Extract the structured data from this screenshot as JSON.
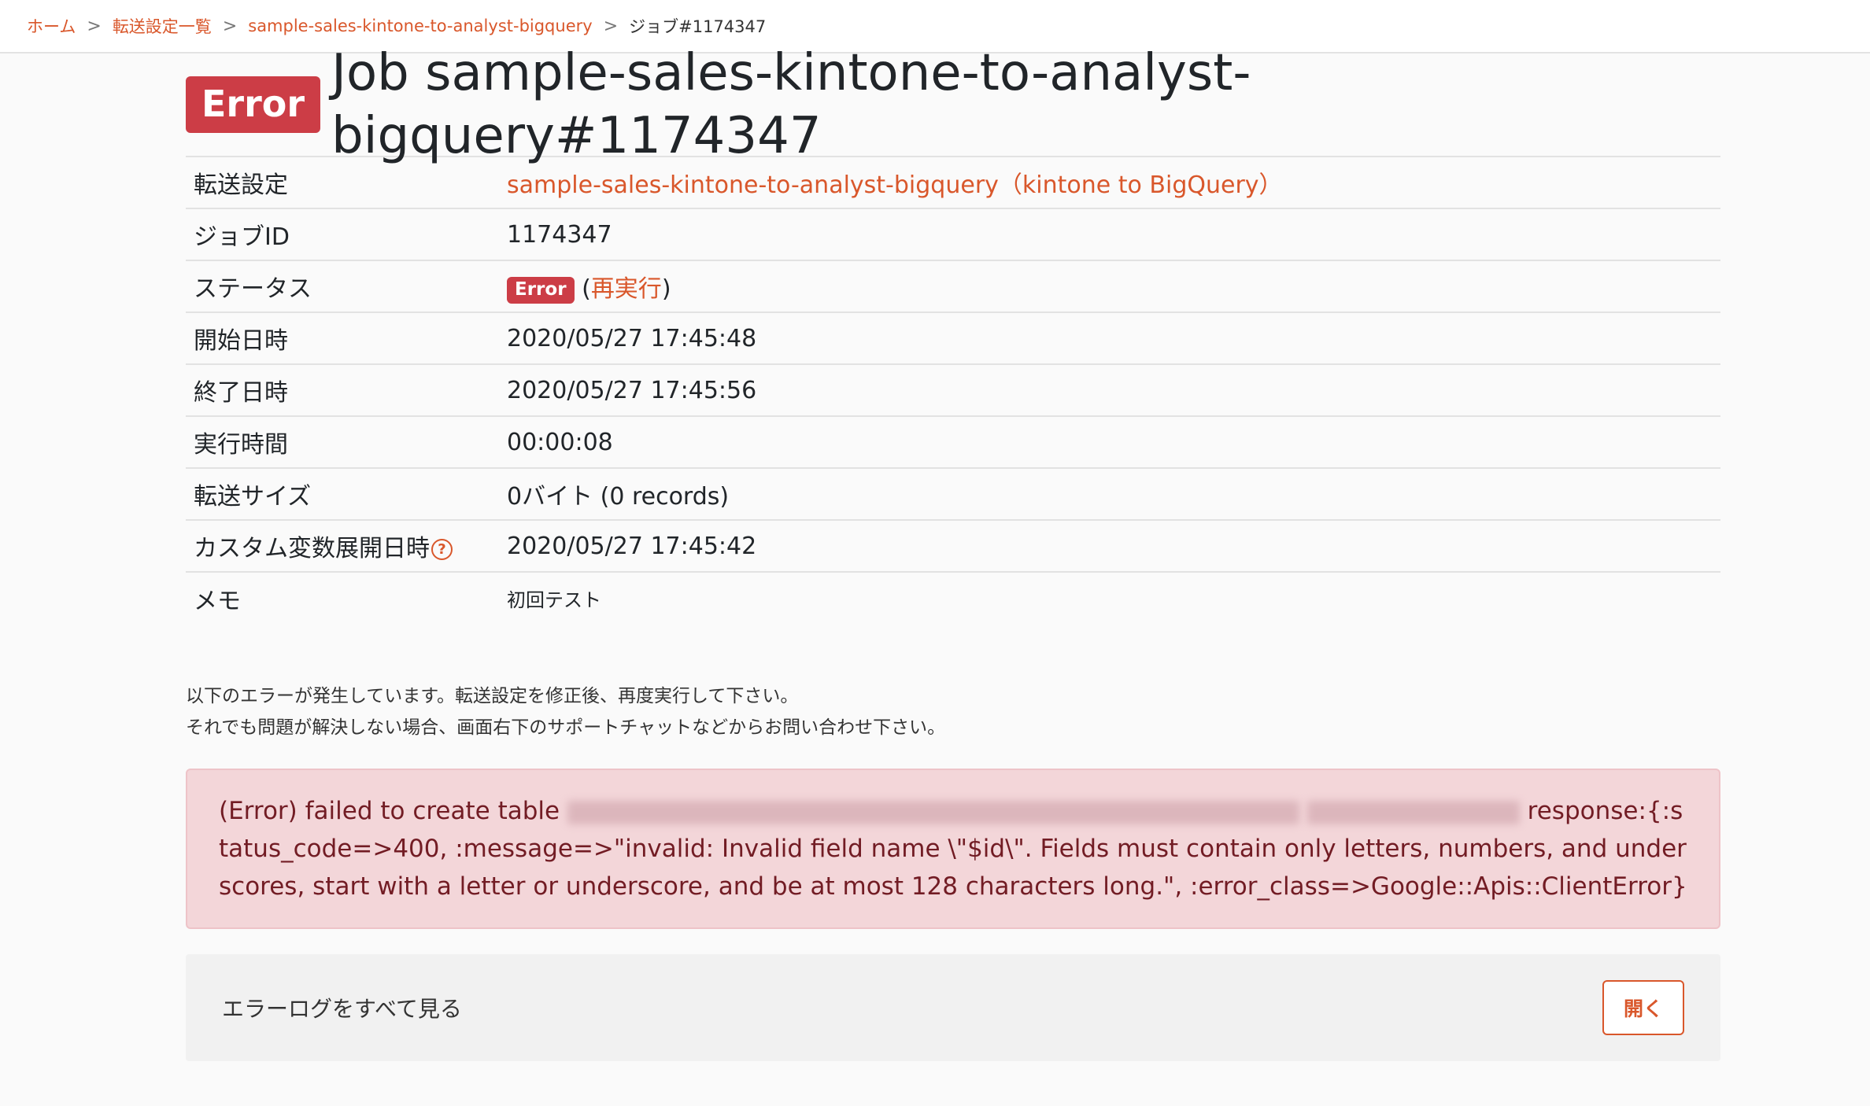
{
  "breadcrumb": {
    "home": "ホーム",
    "list": "転送設定一覧",
    "config": "sample-sales-kintone-to-analyst-bigquery",
    "current": "ジョブ#1174347",
    "separator": ">"
  },
  "title": {
    "badge": "Error",
    "text": "Job sample-sales-kintone-to-analyst-bigquery#1174347"
  },
  "info": {
    "transfer_label": "転送設定",
    "transfer_value": "sample-sales-kintone-to-analyst-bigquery（kintone to BigQuery）",
    "jobid_label": "ジョブID",
    "jobid_value": "1174347",
    "status_label": "ステータス",
    "status_badge": "Error",
    "status_open_paren": "(",
    "rerun_link": "再実行",
    "status_close_paren": ")",
    "start_label": "開始日時",
    "start_value": "2020/05/27 17:45:48",
    "end_label": "終了日時",
    "end_value": "2020/05/27 17:45:56",
    "duration_label": "実行時間",
    "duration_value": "00:00:08",
    "size_label": "転送サイズ",
    "size_value": "0バイト (0 records)",
    "custom_label": "カスタム変数展開日時",
    "custom_help": "?",
    "custom_value": "2020/05/27 17:45:42",
    "memo_label": "メモ",
    "memo_value": "初回テスト"
  },
  "notice": {
    "line1": "以下のエラーが発生しています。転送設定を修正後、再度実行して下さい。",
    "line2": "それでも問題が解決しない場合、画面右下のサポートチャットなどからお問い合わせ下さい。"
  },
  "error": {
    "prefix": "(Error) failed to create table",
    "suffix": "response:{:status_code=>400, :message=>\"invalid: Invalid field name \\\"$id\\\". Fields must contain only letters, numbers, and underscores, start with a letter or underscore, and be at most 128 characters long.\", :error_class=>Google::Apis::ClientError}"
  },
  "log_panel": {
    "label": "エラーログをすべて見る",
    "open_button": "開く"
  },
  "colors": {
    "accent": "#d9572b",
    "error_badge": "#cc3d46",
    "alert_bg": "#f3d6d9",
    "alert_text": "#721c24"
  }
}
